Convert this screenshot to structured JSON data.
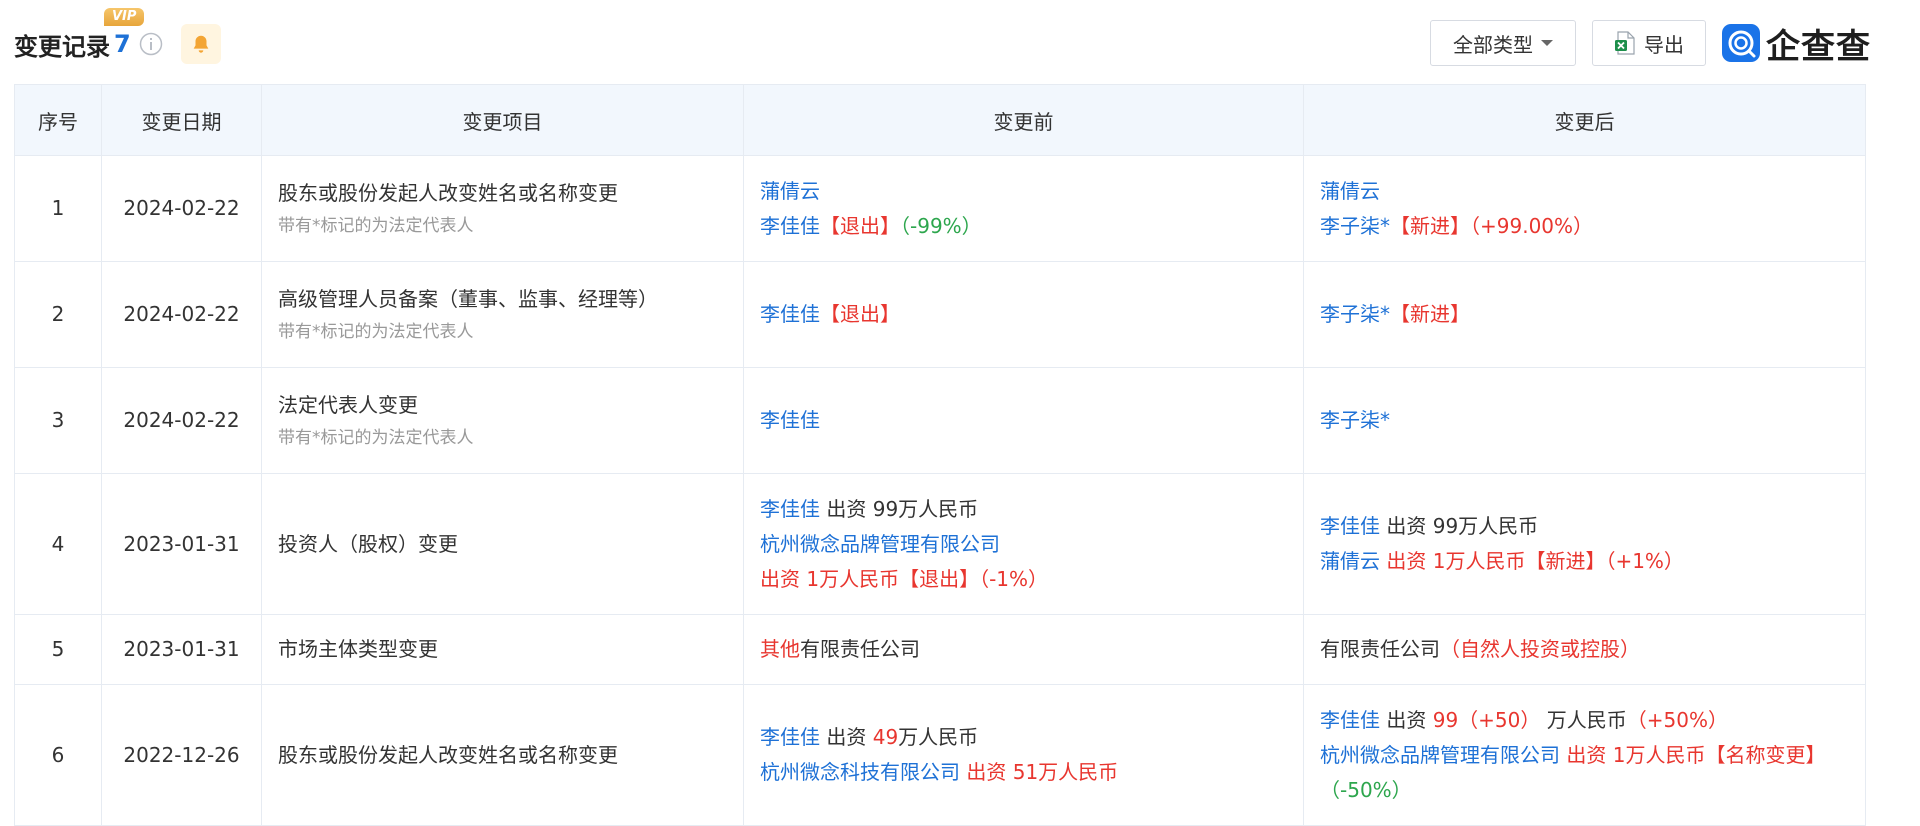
{
  "header": {
    "title": "变更记录",
    "count": "7",
    "vip_badge": "VIP",
    "type_filter": "全部类型",
    "export_label": "导出",
    "logo_text": "企查查"
  },
  "table": {
    "columns": [
      "序号",
      "变更日期",
      "变更项目",
      "变更前",
      "变更后"
    ],
    "rows": [
      {
        "index": "1",
        "date": "2024-02-22",
        "item": "股东或股份发起人改变姓名或名称变更",
        "note": "带有*标记的为法定代表人",
        "before": [
          [
            {
              "t": "蒲倩云",
              "c": "blue"
            }
          ],
          [
            {
              "t": "李佳佳",
              "c": "blue"
            },
            {
              "t": "【退出】",
              "c": "red"
            },
            {
              "t": "（-99%）",
              "c": "green"
            }
          ]
        ],
        "after": [
          [
            {
              "t": "蒲倩云",
              "c": "blue"
            }
          ],
          [
            {
              "t": "李子柒*",
              "c": "blue"
            },
            {
              "t": "【新进】",
              "c": "red"
            },
            {
              "t": "（+99.00%）",
              "c": "red"
            }
          ]
        ]
      },
      {
        "index": "2",
        "date": "2024-02-22",
        "item": "高级管理人员备案（董事、监事、经理等）",
        "note": "带有*标记的为法定代表人",
        "before": [
          [
            {
              "t": "李佳佳",
              "c": "blue"
            },
            {
              "t": "【退出】",
              "c": "red"
            }
          ]
        ],
        "after": [
          [
            {
              "t": "李子柒*",
              "c": "blue"
            },
            {
              "t": "【新进】",
              "c": "red"
            }
          ]
        ]
      },
      {
        "index": "3",
        "date": "2024-02-22",
        "item": "法定代表人变更",
        "note": "带有*标记的为法定代表人",
        "before": [
          [
            {
              "t": "李佳佳",
              "c": "blue"
            }
          ]
        ],
        "after": [
          [
            {
              "t": "李子柒*",
              "c": "blue"
            }
          ]
        ]
      },
      {
        "index": "4",
        "date": "2023-01-31",
        "item": "投资人（股权）变更",
        "note": "",
        "before": [
          [
            {
              "t": "李佳佳",
              "c": "blue"
            },
            {
              "t": " 出资 99万人民币",
              "c": "dark"
            }
          ],
          [
            {
              "t": "杭州微念品牌管理有限公司",
              "c": "blue"
            },
            {
              "t": " 出资 1万人民币【退出】（-1%）",
              "c": "red"
            }
          ]
        ],
        "after": [
          [
            {
              "t": "李佳佳",
              "c": "blue"
            },
            {
              "t": " 出资 99万人民币",
              "c": "dark"
            }
          ],
          [
            {
              "t": "蒲倩云",
              "c": "blue"
            },
            {
              "t": " 出资 1万人民币【新进】（+1%）",
              "c": "red"
            }
          ]
        ]
      },
      {
        "index": "5",
        "date": "2023-01-31",
        "item": "市场主体类型变更",
        "note": "",
        "before": [
          [
            {
              "t": "其他",
              "c": "red"
            },
            {
              "t": "有限责任公司",
              "c": "dark"
            }
          ]
        ],
        "after": [
          [
            {
              "t": "有限责任公司",
              "c": "dark"
            },
            {
              "t": "（自然人投资或控股）",
              "c": "red"
            }
          ]
        ]
      },
      {
        "index": "6",
        "date": "2022-12-26",
        "item": "股东或股份发起人改变姓名或名称变更",
        "note": "",
        "before": [
          [
            {
              "t": "李佳佳",
              "c": "blue"
            },
            {
              "t": " 出资 ",
              "c": "dark"
            },
            {
              "t": "49",
              "c": "red"
            },
            {
              "t": "万人民币",
              "c": "dark"
            }
          ],
          [
            {
              "t": "杭州微念科技有限公司",
              "c": "blue"
            },
            {
              "t": " 出资 51万人民币",
              "c": "red"
            }
          ]
        ],
        "after": [
          [
            {
              "t": "李佳佳",
              "c": "blue"
            },
            {
              "t": " 出资 ",
              "c": "dark"
            },
            {
              "t": "99（+50）",
              "c": "red"
            },
            {
              "t": " 万人民币",
              "c": "dark"
            },
            {
              "t": "（+50%）",
              "c": "red"
            }
          ],
          [
            {
              "t": "杭州微念品牌管理有限公司",
              "c": "blue"
            },
            {
              "t": " 出资 1万人民币【名称变更】",
              "c": "red"
            },
            {
              "t": "（-50%）",
              "c": "green"
            }
          ]
        ]
      }
    ]
  },
  "colors": {
    "accent": "#1e71d6",
    "red": "#e8362f",
    "green": "#2da64d",
    "header_bg": "#f2f7fd"
  }
}
